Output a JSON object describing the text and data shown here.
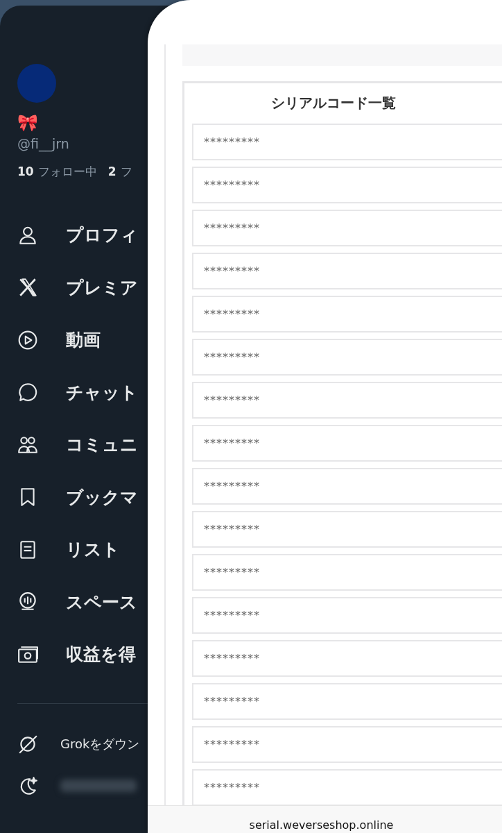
{
  "drawer": {
    "emoji": "🎀",
    "handle": "@fi__jrn",
    "following_count": "10",
    "following_label": "フォロー中",
    "followers_count": "2",
    "followers_label": "フ",
    "menu": [
      {
        "kind": "person",
        "label": "プロフィ"
      },
      {
        "kind": "x",
        "label": "プレミア"
      },
      {
        "kind": "video",
        "label": "動画"
      },
      {
        "kind": "chat",
        "label": "チャット"
      },
      {
        "kind": "community",
        "label": "コミュニ"
      },
      {
        "kind": "bookmark",
        "label": "ブックマ"
      },
      {
        "kind": "list",
        "label": "リスト"
      },
      {
        "kind": "spaces",
        "label": "スペース"
      },
      {
        "kind": "money",
        "label": "収益を得"
      }
    ],
    "footer": [
      {
        "kind": "grok",
        "label": "Grokをダウン"
      },
      {
        "kind": "moon",
        "blurred": true
      }
    ]
  },
  "browser": {
    "title": "シリアルコード一覧",
    "codes": [
      "*********",
      "*********",
      "*********",
      "*********",
      "*********",
      "*********",
      "*********",
      "*********",
      "*********",
      "*********",
      "*********",
      "*********",
      "*********",
      "*********",
      "*********",
      "*********"
    ],
    "url": "serial.weverseshop.online"
  }
}
